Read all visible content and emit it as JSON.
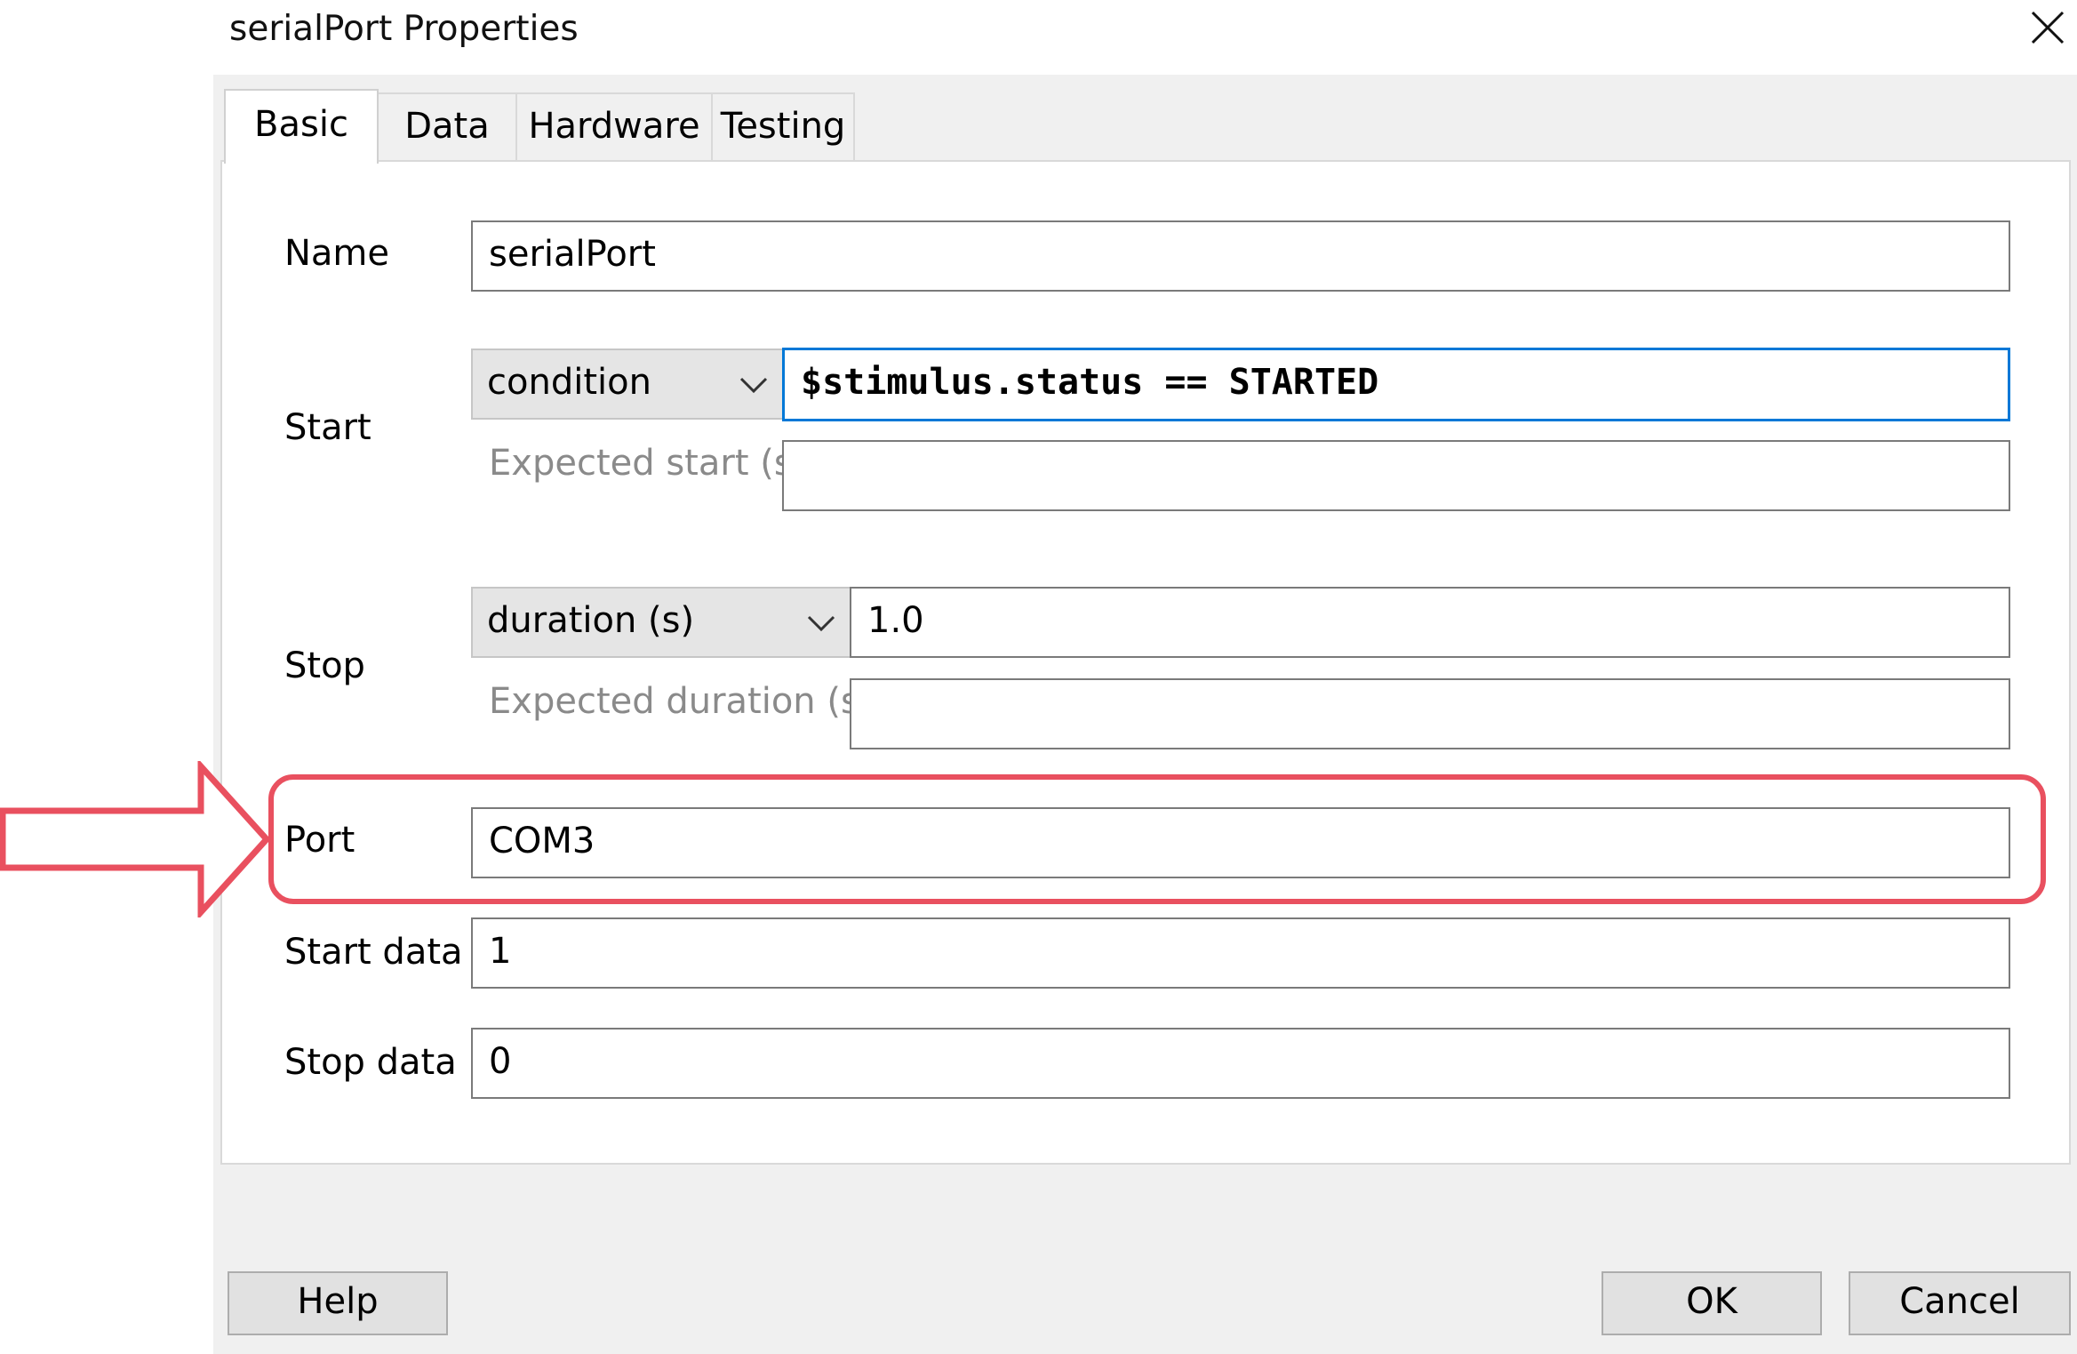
{
  "window": {
    "title": "serialPort Properties",
    "close_icon": "close-icon"
  },
  "tabs": [
    {
      "label": "Basic",
      "active": true
    },
    {
      "label": "Data",
      "active": false
    },
    {
      "label": "Hardware",
      "active": false
    },
    {
      "label": "Testing",
      "active": false
    }
  ],
  "form": {
    "name": {
      "label": "Name",
      "value": "serialPort"
    },
    "start": {
      "label": "Start",
      "type_selected": "condition",
      "value": "$stimulus.status == STARTED",
      "expected_label": "Expected start (s)",
      "expected_value": ""
    },
    "stop": {
      "label": "Stop",
      "type_selected": "duration (s)",
      "value": "1.0",
      "expected_label": "Expected duration (s)",
      "expected_value": ""
    },
    "port": {
      "label": "Port",
      "value": "COM3",
      "highlighted": true
    },
    "start_data": {
      "label": "Start data",
      "value": "1"
    },
    "stop_data": {
      "label": "Stop data",
      "value": "0"
    }
  },
  "buttons": {
    "help": "Help",
    "ok": "OK",
    "cancel": "Cancel"
  },
  "colors": {
    "annotation": "#e9505f",
    "focus": "#0078d7",
    "panel_bg": "#f0f0f0"
  }
}
